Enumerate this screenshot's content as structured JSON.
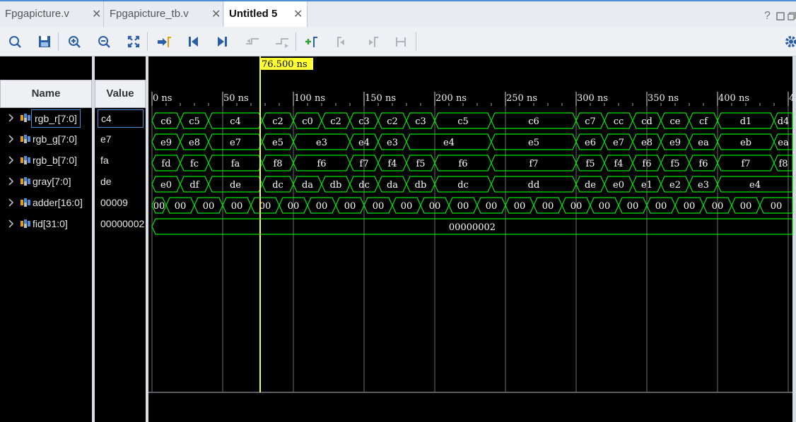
{
  "tabs": [
    {
      "label": "Fpgapicture.v",
      "active": false
    },
    {
      "label": "Fpgapicture_tb.v",
      "active": false
    },
    {
      "label": "Untitled 5",
      "active": true
    }
  ],
  "window_controls": {
    "help": "?"
  },
  "toolbar_icons": [
    "search-icon",
    "save-icon",
    "zoom-in-icon",
    "zoom-out-icon",
    "zoom-fit-icon",
    "go-to-cursor-icon",
    "go-to-start-icon",
    "go-to-end-icon",
    "previous-transition-icon",
    "next-transition-icon",
    "add-marker-icon",
    "previous-marker-icon",
    "next-marker-icon",
    "swap-cursors-icon",
    "settings-icon"
  ],
  "columns": {
    "name": "Name",
    "value": "Value"
  },
  "signals": [
    {
      "name": "rgb_r[7:0]",
      "value": "c4",
      "selected": true
    },
    {
      "name": "rgb_g[7:0]",
      "value": "e7"
    },
    {
      "name": "rgb_b[7:0]",
      "value": "fa"
    },
    {
      "name": "gray[7:0]",
      "value": "de"
    },
    {
      "name": "adder[16:0]",
      "value": "00009"
    },
    {
      "name": "fid[31:0]",
      "value": "00000002"
    }
  ],
  "cursor": {
    "label": "76.500 ns",
    "time_ns": 76.5
  },
  "timeline": {
    "start_ns": 0,
    "ticks": [
      "0 ns",
      "50 ns",
      "100 ns",
      "150 ns",
      "200 ns",
      "250 ns",
      "300 ns",
      "350 ns",
      "400 ns",
      "4"
    ]
  },
  "waves": [
    {
      "signal": "rgb_r[7:0]",
      "values": [
        "c6",
        "c5",
        "c4",
        "c2",
        "c0",
        "c2",
        "c3",
        "c2",
        "c3",
        "c5",
        "c6",
        "c7",
        "cc",
        "cd",
        "ce",
        "cf",
        "d1",
        "d4"
      ]
    },
    {
      "signal": "rgb_g[7:0]",
      "values": [
        "e9",
        "e8",
        "e7",
        "e5",
        "e3",
        "e4",
        "e3",
        "e4",
        "e5",
        "e6",
        "e7",
        "e8",
        "e9",
        "ea",
        "eb",
        "ea"
      ]
    },
    {
      "signal": "rgb_b[7:0]",
      "values": [
        "fd",
        "fc",
        "fa",
        "f8",
        "f6",
        "f7",
        "f4",
        "f5",
        "f6",
        "f7",
        "f5",
        "f4",
        "f6",
        "f5",
        "f6",
        "f7",
        "f8"
      ]
    },
    {
      "signal": "gray[7:0]",
      "values": [
        "e0",
        "df",
        "de",
        "dc",
        "da",
        "db",
        "dc",
        "da",
        "db",
        "dc",
        "dd",
        "de",
        "e0",
        "e1",
        "e2",
        "e3",
        "e4"
      ]
    },
    {
      "signal": "adder[16:0]",
      "values": [
        "00",
        "00",
        "00",
        "00",
        "00",
        "00",
        "00",
        "00",
        "00",
        "00",
        "00",
        "00",
        "00",
        "00",
        "00",
        "00",
        "00",
        "00",
        "00",
        "00",
        "00",
        "00",
        "00"
      ]
    },
    {
      "signal": "fid[31:0]",
      "values": [
        "00000002"
      ]
    }
  ],
  "colors": {
    "wave": "#00e600",
    "cursor": "#ffff33",
    "grid": "#707070",
    "tab_accent": "#4a8fd6"
  }
}
